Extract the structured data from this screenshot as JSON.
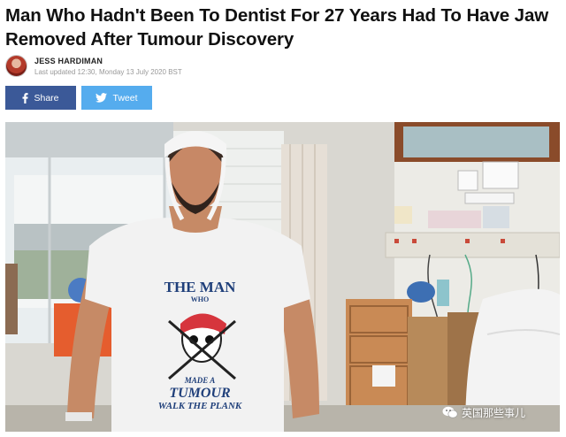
{
  "article": {
    "headline": "Man Who Hadn't Been To Dentist For 27 Years Had To Have Jaw Removed After Tumour Discovery",
    "author": "JESS HARDIMAN",
    "updated": "Last updated 12:30, Monday 13 July 2020 BST"
  },
  "share": {
    "facebook_label": "Share",
    "twitter_label": "Tweet"
  },
  "photo": {
    "shirt_text_line1": "THE MAN",
    "shirt_text_line2": "WHO",
    "shirt_text_line3": "MADE A",
    "shirt_text_line4": "TUMOUR",
    "shirt_text_line5": "WALK THE PLANK"
  },
  "watermark": {
    "text": "英国那些事儿"
  },
  "colors": {
    "facebook": "#3b5998",
    "twitter": "#55acee",
    "text": "#111111",
    "muted": "#999999"
  }
}
